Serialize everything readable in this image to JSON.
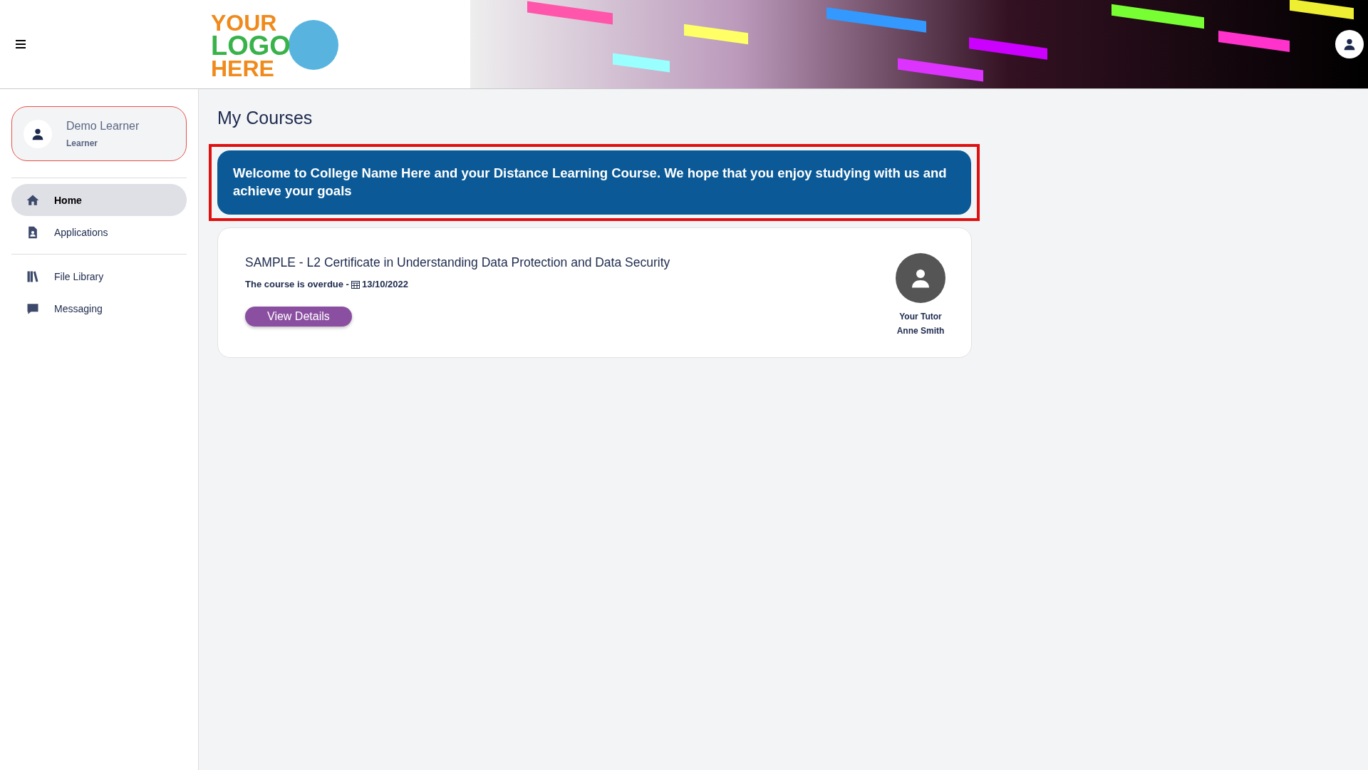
{
  "header": {
    "logo": {
      "lines": [
        "YOUR",
        "LOGO",
        "HERE"
      ]
    }
  },
  "profile": {
    "name": "Demo Learner",
    "role": "Learner"
  },
  "sidebar": {
    "groups": [
      [
        {
          "label": "Home",
          "selected": true
        },
        {
          "label": "Applications",
          "selected": false
        }
      ],
      [
        {
          "label": "File Library",
          "selected": false
        },
        {
          "label": "Messaging",
          "selected": false
        }
      ]
    ]
  },
  "page": {
    "title": "My Courses",
    "welcome": "Welcome to College Name Here and your Distance Learning Course. We hope that you enjoy studying with us and achieve your goals"
  },
  "courses": [
    {
      "title": "SAMPLE - L2 Certificate in Understanding Data Protection and Data Security",
      "status": "The course is overdue - ",
      "date": "13/10/2022",
      "button": "View Details",
      "tutor_label": "Your Tutor",
      "tutor_name": "Anne Smith"
    }
  ]
}
